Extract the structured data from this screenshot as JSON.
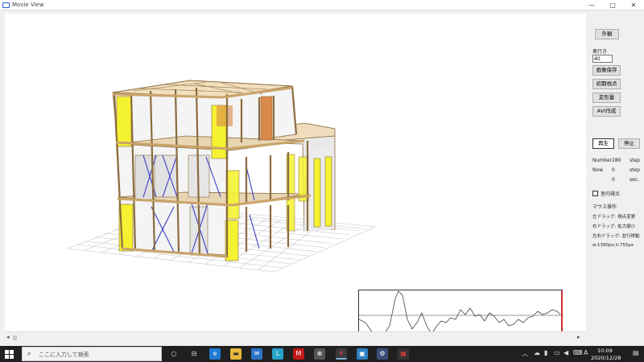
{
  "window": {
    "title": "Movie View",
    "minimize": "—",
    "maximize": "□",
    "close": "✕"
  },
  "panel": {
    "exterior_button": "外観",
    "depth_label": "奥行き",
    "depth_value": "40",
    "save_image_button": "画像保存",
    "initial_view_button": "初期視点",
    "deformation_button": "変形量",
    "avi_button": "AVI作成",
    "play_button": "再生",
    "stop_button": "停止",
    "number_label": "Number",
    "number_value": "280",
    "number_unit": "step",
    "now_label": "Now",
    "now_value": "0",
    "now_unit": "step",
    "sec_value": "0",
    "sec_unit": "sec.",
    "indoor_view_label": "室内視点",
    "indoor_view_checked": false,
    "mouse_title": "マウス操作",
    "mouse_left": "左ドラッグ: 視点変更",
    "mouse_right": "右ドラッグ: 拡大縮小",
    "mouse_both": "左右ドラッグ: 並行移動",
    "size_text": "w:1390px,h:755px"
  },
  "taskbar": {
    "search_placeholder": "ここに入力して検索",
    "time": "10:09",
    "date": "2020/12/28",
    "ime": "A",
    "icons": [
      "windows-start-icon",
      "search-icon",
      "cortana-icon",
      "task-view-icon",
      "edge-icon",
      "file-explorer-icon",
      "mail-icon",
      "store-l-icon",
      "mcafee-icon",
      "xbox-icon",
      "app-red-icon",
      "photos-icon",
      "settings-gear-icon",
      "media-icon"
    ]
  },
  "colors": {
    "wall_yellow": "#f5f232",
    "wall_orange": "#d9894a",
    "brace_blue": "#3b3bc8",
    "frame_wood": "#e8c999",
    "wave_marker": "#cc3333"
  }
}
